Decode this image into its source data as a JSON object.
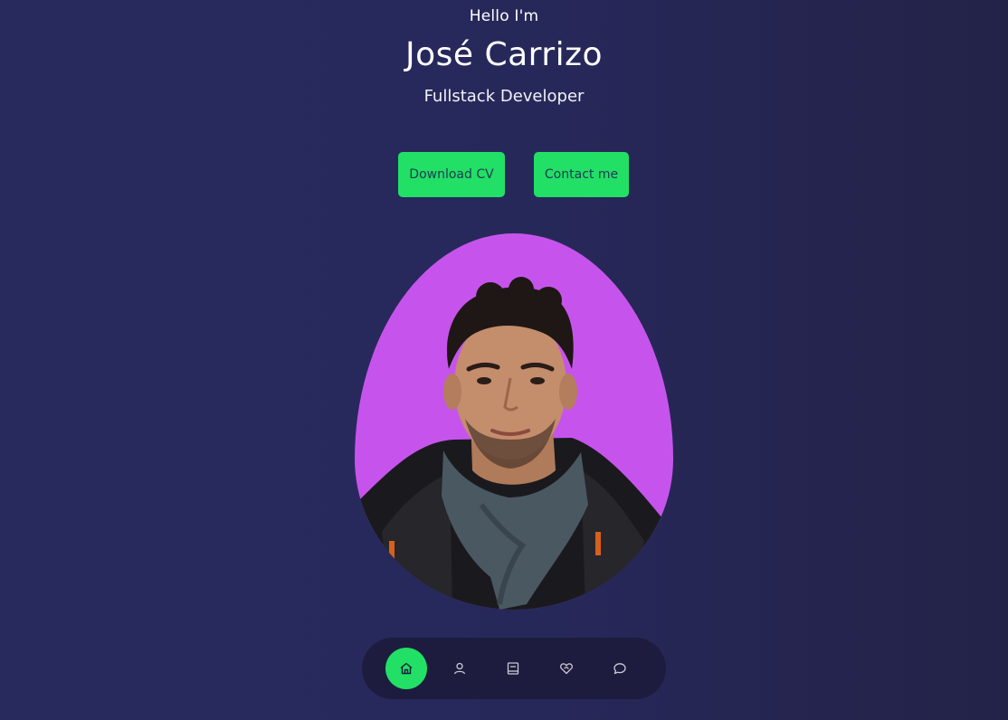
{
  "hero": {
    "greeting": "Hello I'm",
    "name": "José Carrizo",
    "role": "Fullstack Developer"
  },
  "actions": {
    "download_cv": "Download CV",
    "contact": "Contact me"
  },
  "colors": {
    "accent": "#21e065",
    "portrait_background": "#c654ec",
    "page_background": "#27285a",
    "dock_background": "#1d1c3e"
  },
  "nav": {
    "items": [
      {
        "icon": "home-icon",
        "active": true
      },
      {
        "icon": "user-icon",
        "active": false
      },
      {
        "icon": "book-icon",
        "active": false
      },
      {
        "icon": "handshake-icon",
        "active": false
      },
      {
        "icon": "chat-icon",
        "active": false
      }
    ]
  }
}
